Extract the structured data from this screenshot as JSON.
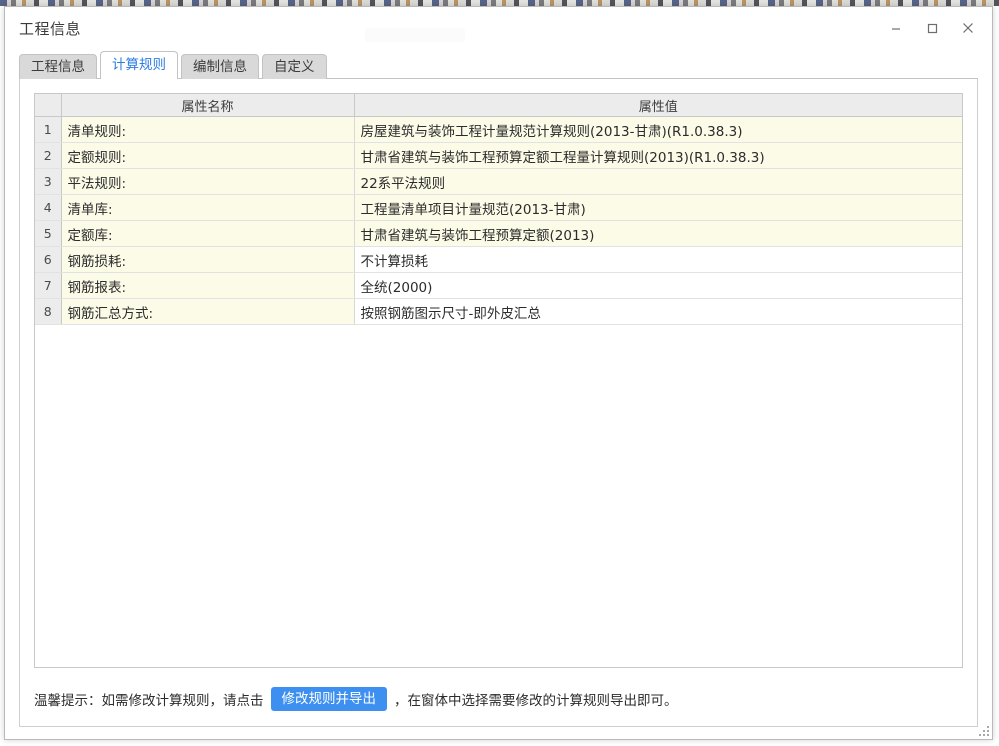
{
  "window": {
    "title": "工程信息",
    "controls": [
      {
        "name": "minimize",
        "glyph": "minimize-icon"
      },
      {
        "name": "maximize",
        "glyph": "maximize-icon"
      },
      {
        "name": "close",
        "glyph": "close-icon"
      }
    ]
  },
  "tabs": [
    {
      "label": "工程信息",
      "active": false
    },
    {
      "label": "计算规则",
      "active": true
    },
    {
      "label": "编制信息",
      "active": false
    },
    {
      "label": "自定义",
      "active": false
    }
  ],
  "table": {
    "headers": {
      "num": "",
      "name": "属性名称",
      "value": "属性值"
    },
    "rows": [
      {
        "num": "1",
        "name": "清单规则:",
        "value": "房屋建筑与装饰工程计量规范计算规则(2013-甘肃)(R1.0.38.3)"
      },
      {
        "num": "2",
        "name": "定额规则:",
        "value": "甘肃省建筑与装饰工程预算定额工程量计算规则(2013)(R1.0.38.3)"
      },
      {
        "num": "3",
        "name": "平法规则:",
        "value": "22系平法规则"
      },
      {
        "num": "4",
        "name": "清单库:",
        "value": "工程量清单项目计量规范(2013-甘肃)"
      },
      {
        "num": "5",
        "name": "定额库:",
        "value": "甘肃省建筑与装饰工程预算定额(2013)"
      },
      {
        "num": "6",
        "name": "钢筋损耗:",
        "value": "不计算损耗"
      },
      {
        "num": "7",
        "name": "钢筋报表:",
        "value": "全统(2000)"
      },
      {
        "num": "8",
        "name": "钢筋汇总方式:",
        "value": "按照钢筋图示尺寸-即外皮汇总"
      }
    ]
  },
  "tip": {
    "prefix": "温馨提示：如需修改计算规则，请点击",
    "button_label": "修改规则并导出",
    "suffix": "，在窗体中选择需要修改的计算规则导出即可。"
  },
  "colors": {
    "accent_blue": "#3d90f0",
    "active_tab_text": "#2e7de0",
    "row_cream": "#fcfbe8",
    "header_gray": "#ececec"
  }
}
